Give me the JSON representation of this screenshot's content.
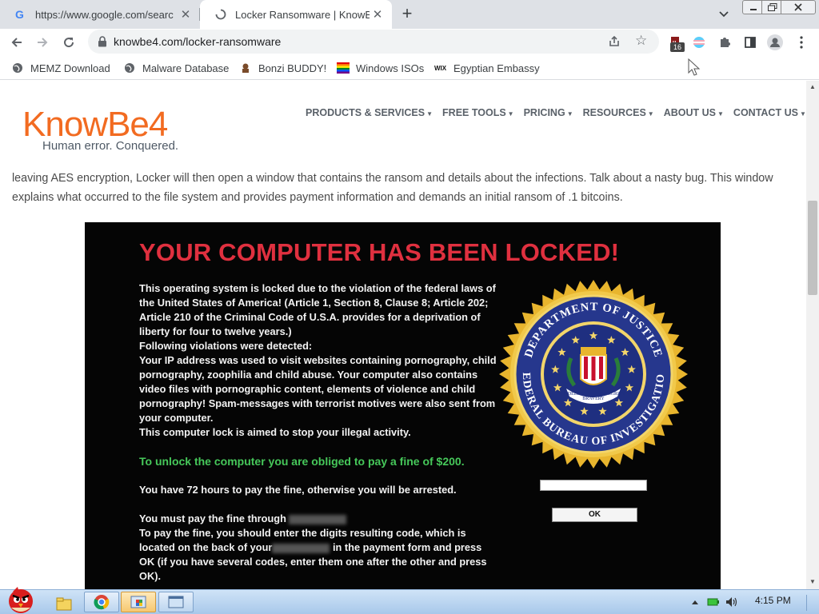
{
  "browser": {
    "tabs": [
      {
        "title": "https://www.google.com/searc",
        "icon": "google-favicon"
      },
      {
        "title": "Locker Ransomware | KnowBe",
        "icon": "loading-spinner-icon"
      }
    ],
    "url": "knowbe4.com/locker-ransomware",
    "extension_badge": "16",
    "bookmarks": [
      {
        "label": "MEMZ Download",
        "icon": "globe-icon"
      },
      {
        "label": "Malware Database",
        "icon": "globe-icon"
      },
      {
        "label": "Bonzi BUDDY!",
        "icon": "bonzi-icon"
      },
      {
        "label": "Windows ISOs",
        "icon": "rainbow-flag-icon"
      },
      {
        "label": "Egyptian Embassy",
        "icon": "wix-icon"
      }
    ]
  },
  "site": {
    "logo": {
      "word": "KnowBe4",
      "tagline": "Human error. Conquered."
    },
    "nav": [
      "PRODUCTS & SERVICES",
      "FREE TOOLS",
      "PRICING",
      "RESOURCES",
      "ABOUT US",
      "CONTACT US"
    ],
    "article_text": "leaving AES encryption, Locker will then open a window that contains the ransom and details about the infections. Talk about a nasty bug. This window explains what occurred to the file system and provides payment information and demands an initial ransom of .1 bitcoins."
  },
  "ransom": {
    "title": "YOUR COMPUTER HAS BEEN LOCKED!",
    "body1": "This operating system is locked due to the violation of the federal laws of the United States of America! (Article 1, Section 8, Clause 8; Article 202; Article 210 of the Criminal Code of U.S.A. provides for a deprivation of liberty for four to twelve years.)",
    "body1b": "Following violations were detected:",
    "body1c": "Your  IP address was used to visit websites containing pornography, child pornography, zoophilia and child abuse. Your computer also contains video files with pornographic content, elements of violence and child pornography! Spam-messages with terrorist motives were also sent from your computer.",
    "body1d": "This computer lock is aimed to stop your illegal activity.",
    "unlock_line": "To unlock the computer you are obliged to pay a fine of $200.",
    "hours_pre": "You have ",
    "hours_bold": "72 hours",
    "hours_mid": " to pay the fine, otherwise you will be ",
    "hours_end": "arrested",
    "hours_dot": ".",
    "pay_pre": "You must pay the fine through",
    "pay_line2": "To pay the fine, you should enter the  digits resulting code, which is located on the back of your",
    "pay_line2b": "in the payment form and press OK (if you have several codes, enter them one after the other and press OK).",
    "ok_label": "OK",
    "seal": {
      "top_text": "DEPARTMENT OF JUSTICE",
      "bottom_text": "FEDERAL BUREAU OF INVESTIGATION",
      "ribbon": [
        "FIDELITY",
        "BRAVERY",
        "INTEGRITY"
      ]
    }
  },
  "taskbar": {
    "clock": "4:15 PM"
  },
  "colors": {
    "brand_orange": "#f26b21",
    "ransom_red": "#e0303f",
    "ransom_green": "#46c85a",
    "seal_blue": "#2b3e9a",
    "seal_gold": "#e8b52e"
  }
}
